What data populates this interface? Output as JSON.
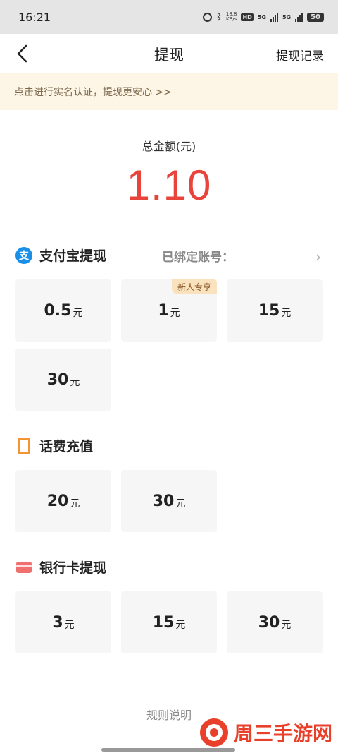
{
  "status": {
    "time": "16:21",
    "speed_value": "18.8",
    "speed_unit": "KB/s",
    "hd": "HD",
    "net1": "5G",
    "net2": "5G",
    "battery": "50"
  },
  "nav": {
    "title": "提现",
    "record": "提现记录"
  },
  "notice": "点击进行实名认证，提现更安心 >>",
  "total": {
    "label": "总金额(元)",
    "amount": "1.10"
  },
  "alipay": {
    "title": "支付宝提现",
    "icon_char": "支",
    "bound_label": "已绑定账号：",
    "options": [
      {
        "num": "0.5",
        "unit": "元",
        "badge": ""
      },
      {
        "num": "1",
        "unit": "元",
        "badge": "新人专享"
      },
      {
        "num": "15",
        "unit": "元",
        "badge": ""
      },
      {
        "num": "30",
        "unit": "元",
        "badge": ""
      }
    ]
  },
  "phone": {
    "title": "话费充值",
    "options": [
      {
        "num": "20",
        "unit": "元"
      },
      {
        "num": "30",
        "unit": "元"
      }
    ]
  },
  "bank": {
    "title": "银行卡提现",
    "options": [
      {
        "num": "3",
        "unit": "元"
      },
      {
        "num": "15",
        "unit": "元"
      },
      {
        "num": "30",
        "unit": "元"
      }
    ]
  },
  "rules": "规则说明",
  "watermark": "周三手游网",
  "colors": {
    "amount": "#e8443c",
    "alipay": "#1a8fe8",
    "phone": "#f39536",
    "bank": "#f07070",
    "notice_bg": "#fdf6e6"
  },
  "icons": [
    "alarm-icon",
    "bluetooth-icon",
    "signal-icon",
    "battery-icon",
    "back-arrow-icon",
    "alipay-icon",
    "phone-icon",
    "bank-card-icon",
    "chevron-right-icon",
    "watermark-logo-icon"
  ]
}
